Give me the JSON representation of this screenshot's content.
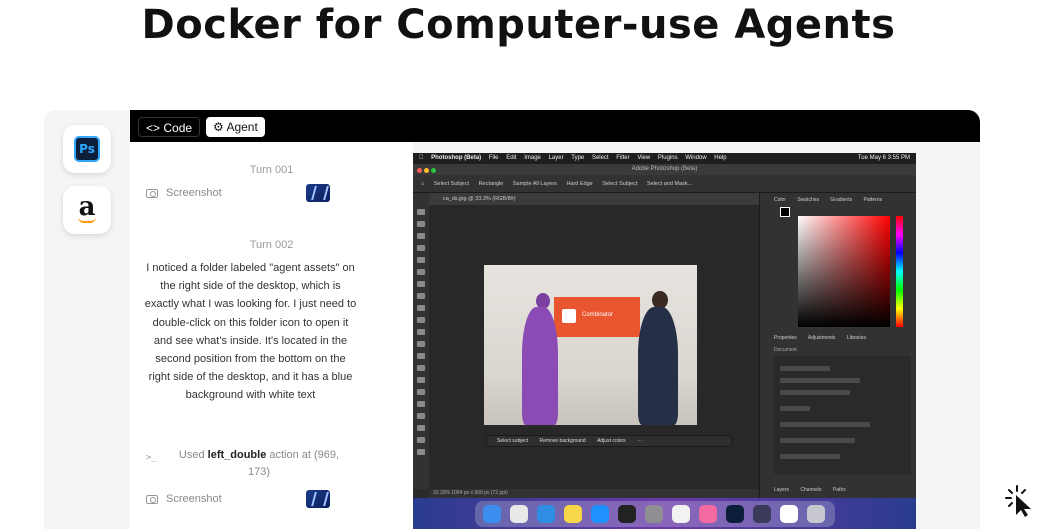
{
  "headline": "Docker for Computer-use Agents",
  "app_rail": [
    {
      "name": "photoshop",
      "glyph": "Ps"
    },
    {
      "name": "amazon",
      "glyph": "a"
    }
  ],
  "tabs": [
    {
      "label": "<> Code",
      "active": false
    },
    {
      "label": "Agent",
      "active": true
    }
  ],
  "chat": {
    "turns": [
      {
        "label": "Turn 001",
        "screenshot_label": "Screenshot"
      },
      {
        "label": "Turn 002",
        "message": "I noticed a folder labeled \"agent assets\" on the right side of the desktop, which is exactly what I was looking for. I just need to double-click on this folder icon to open it and see what's inside. It's located in the second position from the bottom on the right side of the desktop, and it has a blue background with white text",
        "action_prefix": "Used ",
        "action_name": "left_double",
        "action_suffix": " action at (969, 173)",
        "screenshot_label": "Screenshot"
      }
    ]
  },
  "screen": {
    "mac_menubar": {
      "app": "Photoshop (Beta)",
      "items": [
        "File",
        "Edit",
        "Image",
        "Layer",
        "Type",
        "Select",
        "Filter",
        "View",
        "Plugins",
        "Window",
        "Help"
      ],
      "clock": "Tue May 6  3:55 PM"
    },
    "window_title": "Adobe Photoshop (Beta)",
    "options_bar": [
      "Select Subject",
      "Rectangle",
      "Sample All Layers",
      "Hard Edge",
      "Select Subject",
      "Select and Mask..."
    ],
    "document_tab": "ca_ds.jpg @ 33.3% (RGB/8#)",
    "banner_text": "Combinator",
    "contextual_taskbar": [
      "Select subject",
      "Remove background",
      "Adjust colors"
    ],
    "status_bar": "33.33%   1084 px x 960 px (72 ppi)",
    "color_panel_tabs": [
      "Color",
      "Swatches",
      "Gradients",
      "Patterns"
    ],
    "properties_tabs": [
      "Properties",
      "Adjustments",
      "Libraries"
    ],
    "properties_section": "Document",
    "layers_tabs": [
      "Layers",
      "Channels",
      "Paths"
    ],
    "dock_apps": [
      {
        "name": "finder",
        "color": "#3b8ef0"
      },
      {
        "name": "launchpad",
        "color": "#e8e8e8"
      },
      {
        "name": "safari",
        "color": "#2f8de4"
      },
      {
        "name": "notes",
        "color": "#f7d64a"
      },
      {
        "name": "app-store",
        "color": "#1e90ff"
      },
      {
        "name": "terminal",
        "color": "#222222"
      },
      {
        "name": "settings",
        "color": "#8e8e93"
      },
      {
        "name": "textedit",
        "color": "#f2f2f2"
      },
      {
        "name": "photos",
        "color": "#f56aa0"
      },
      {
        "name": "photoshop",
        "color": "#0b1f3a"
      },
      {
        "name": "extensions",
        "color": "#3a3a5a"
      },
      {
        "name": "window",
        "color": "#ffffff"
      },
      {
        "name": "trash",
        "color": "#c8c8d0"
      }
    ]
  }
}
